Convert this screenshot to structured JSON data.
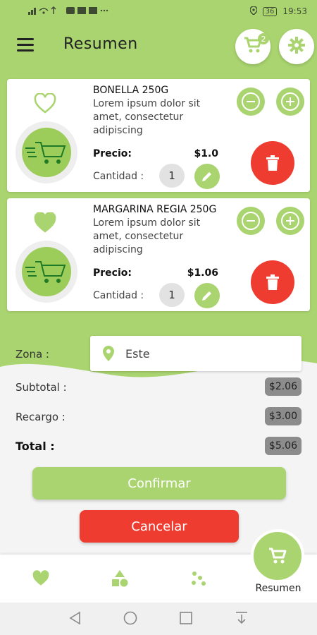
{
  "status_bar": {
    "signal": "..ıl",
    "battery": "36",
    "time": "19:53"
  },
  "header": {
    "title": "Resumen",
    "cart_count": "2"
  },
  "products": [
    {
      "name": "BONELLA 250G",
      "description": "Lorem ipsum dolor sit amet, consectetur adipiscing",
      "price_label": "Precio:",
      "price": "$1.0",
      "quantity_label": "Cantidad :",
      "quantity": "1",
      "favorite": false
    },
    {
      "name": "MARGARINA REGIA 250G",
      "description": "Lorem ipsum dolor sit amet, consectetur adipiscing",
      "price_label": "Precio:",
      "price": "$1.06",
      "quantity_label": "Cantidad :",
      "quantity": "1",
      "favorite": true
    }
  ],
  "zone": {
    "label": "Zona :",
    "value": "Este"
  },
  "summary": {
    "subtotal_label": "Subtotal :",
    "subtotal": "$2.06",
    "surcharge_label": "Recargo :",
    "surcharge": "$3.00",
    "total_label": "Total :",
    "total": "$5.06"
  },
  "actions": {
    "confirm": "Confirmar",
    "cancel": "Cancelar"
  },
  "bottom_nav": {
    "active_label": "Resumen"
  },
  "colors": {
    "primary": "#a9d46f",
    "danger": "#ee3c31",
    "value_chip": "#8c8c8c"
  }
}
